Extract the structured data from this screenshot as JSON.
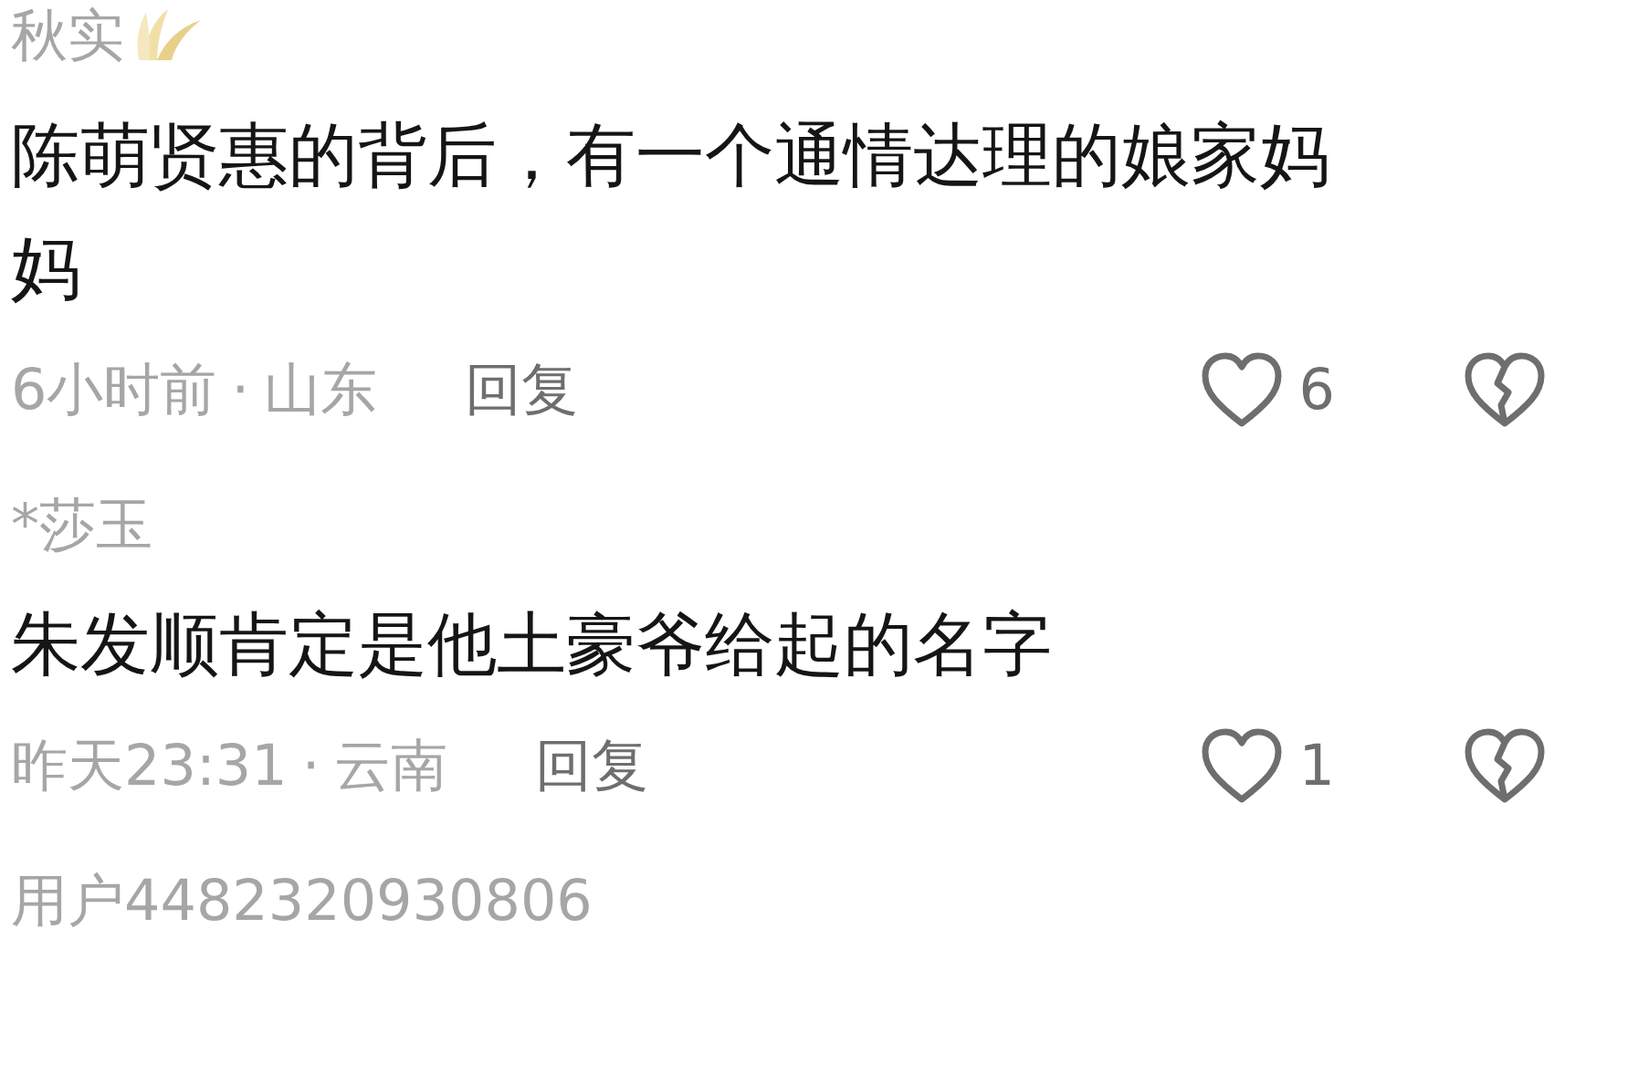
{
  "comments": [
    {
      "user": "秋实",
      "badge": true,
      "text": "陈萌贤惠的背后，有一个通情达理的娘家妈妈",
      "time": "6小时前",
      "separator": "·",
      "location": "山东",
      "reply": "回复",
      "likes": "6"
    },
    {
      "user": "*莎玉",
      "badge": false,
      "text": "朱发顺肯定是他土豪爷给起的名字",
      "time": "昨天23:31",
      "separator": "·",
      "location": "云南",
      "reply": "回复",
      "likes": "1"
    },
    {
      "user": "用户4482320930806"
    }
  ]
}
